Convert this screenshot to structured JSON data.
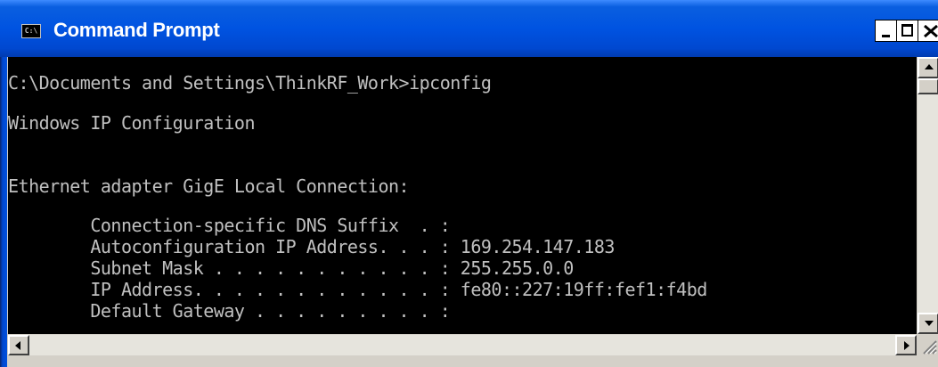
{
  "window": {
    "title": "Command Prompt",
    "icon": "command-prompt-icon",
    "icon_text": "C:\\"
  },
  "console": {
    "lines": [
      "C:\\Documents and Settings\\ThinkRF_Work>ipconfig",
      "Windows IP Configuration",
      "Ethernet adapter GigE Local Connection:",
      "        Connection-specific DNS Suffix  . :",
      "        Autoconfiguration IP Address. . . : 169.254.147.183",
      "        Subnet Mask . . . . . . . . . . . : 255.255.0.0",
      "        IP Address. . . . . . . . . . . . : fe80::227:19ff:fef1:f4bd",
      "        Default Gateway . . . . . . . . . :"
    ]
  },
  "colors": {
    "title_bar": "#0053e1",
    "console_background": "#000000",
    "console_text": "#c0c0c0"
  }
}
